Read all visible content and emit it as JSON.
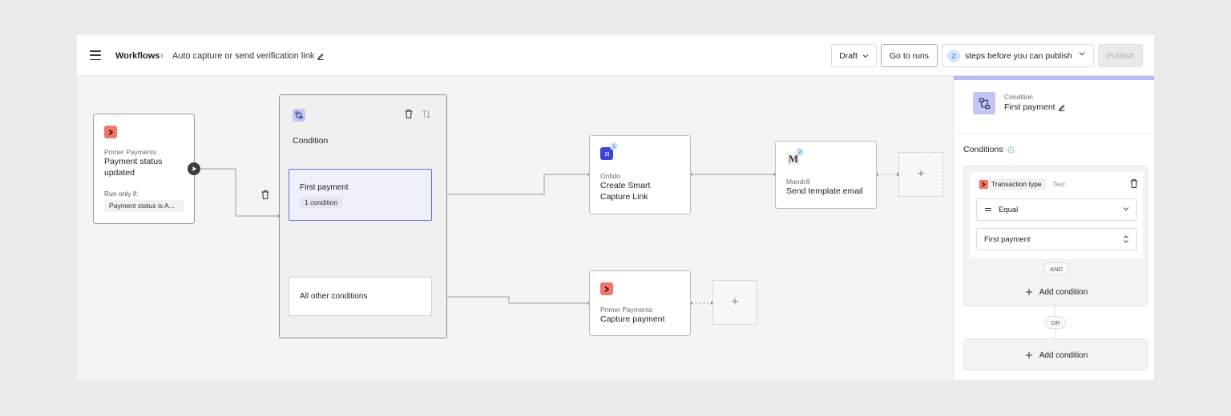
{
  "header": {
    "breadcrumb_root": "Workflows",
    "breadcrumb_separator": "›",
    "breadcrumb_current": "Auto capture or send verification link",
    "status_select": "Draft",
    "go_to_runs": "Go to runs",
    "steps_count": "2",
    "steps_text": "steps before you can publish",
    "publish": "Publish"
  },
  "canvas": {
    "trigger": {
      "app": "Primer Payments",
      "title": "Payment status updated",
      "run_only_label": "Run only if:",
      "run_only_value": "Payment status is A..."
    },
    "condition_block": {
      "title": "Condition",
      "branches": [
        {
          "label": "First payment",
          "chip": "1 condition"
        },
        {
          "label": "All other conditions"
        }
      ]
    },
    "onfido": {
      "app": "Onfido",
      "title": "Create Smart Capture Link",
      "badge": "1"
    },
    "mandrill": {
      "app": "Mandrill",
      "title": "Send template email",
      "badge": "2",
      "logo": "M"
    },
    "capture": {
      "app": "Primer Payments",
      "title": "Capture payment"
    },
    "add_symbol": "+"
  },
  "panel": {
    "type_label": "Condition",
    "name": "First payment",
    "section_title": "Conditions",
    "rule": {
      "field": "Transaction type",
      "field_type": "Text",
      "operator": "Equal",
      "value": "First payment"
    },
    "and_label": "AND",
    "or_label": "OR",
    "add_condition": "Add condition"
  },
  "colors": {
    "accent": "#6c71d6",
    "primer": "#f0776a",
    "onfido": "#3d43e0",
    "condition": "#c3c6f3"
  }
}
